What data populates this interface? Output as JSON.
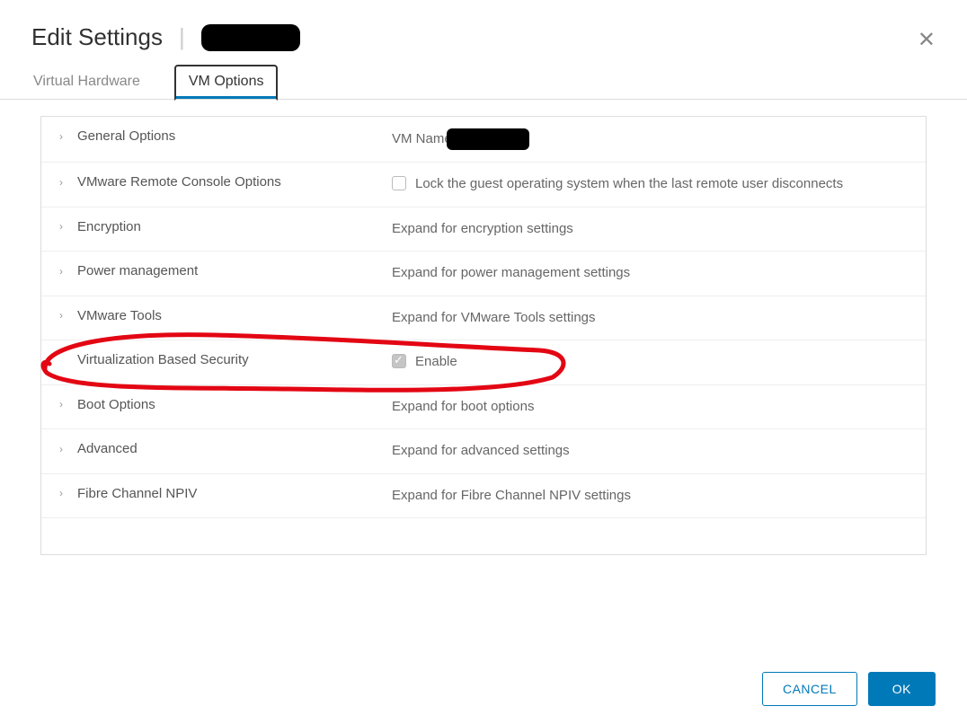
{
  "header": {
    "title": "Edit Settings"
  },
  "tabs": {
    "hardware": "Virtual Hardware",
    "vmoptions": "VM Options"
  },
  "rows": {
    "general": {
      "label": "General Options",
      "value": "VM Name"
    },
    "remote": {
      "label": "VMware Remote Console Options",
      "value": "Lock the guest operating system when the last remote user disconnects"
    },
    "encryption": {
      "label": "Encryption",
      "value": "Expand for encryption settings"
    },
    "power": {
      "label": "Power management",
      "value": "Expand for power management settings"
    },
    "tools": {
      "label": "VMware Tools",
      "value": "Expand for VMware Tools settings"
    },
    "vbs": {
      "label": "Virtualization Based Security",
      "value": "Enable"
    },
    "boot": {
      "label": "Boot Options",
      "value": "Expand for boot options"
    },
    "advanced": {
      "label": "Advanced",
      "value": "Expand for advanced settings"
    },
    "npiv": {
      "label": "Fibre Channel NPIV",
      "value": "Expand for Fibre Channel NPIV settings"
    }
  },
  "footer": {
    "cancel": "CANCEL",
    "ok": "OK"
  }
}
